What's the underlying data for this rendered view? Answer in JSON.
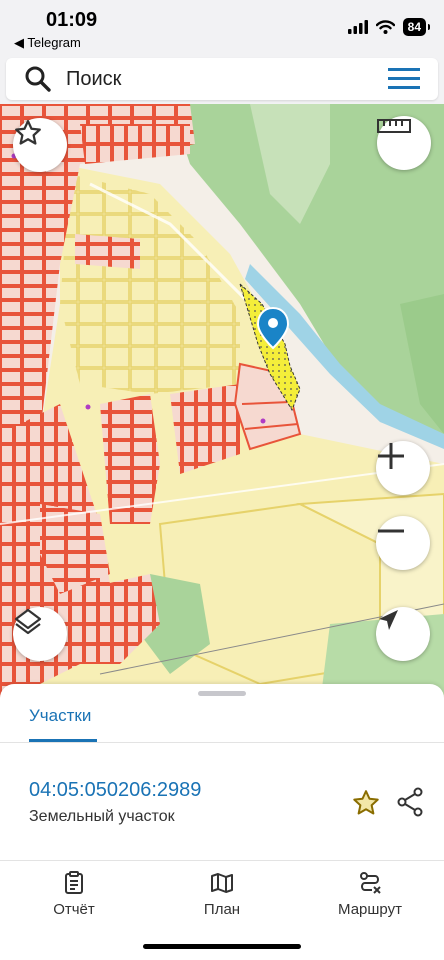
{
  "status_bar": {
    "time": "01:09",
    "back_app": "◀ Telegram",
    "battery": "84"
  },
  "search": {
    "placeholder": "Поиск",
    "icon": "search-icon",
    "menu_icon": "hamburger-menu-icon"
  },
  "map": {
    "buttons": {
      "favorites_icon": "star-icon",
      "ruler_icon": "ruler-icon",
      "zoom_in_icon": "plus-icon",
      "zoom_out_icon": "minus-icon",
      "layers_icon": "layers-icon",
      "locate_icon": "navigation-arrow-icon"
    },
    "colors": {
      "parcel_fill": "#f6d9d0",
      "parcel_outline": "#e8543a",
      "land_fill": "#f7efb6",
      "land_outline": "#e6d26a",
      "forest": "#a9d39a",
      "selected": "#f4ee3a",
      "marker": "#1a84c7"
    }
  },
  "sheet": {
    "tab_label": "Участки",
    "parcel_number": "04:05:050206:2989",
    "parcel_type": "Земельный участок",
    "favorite_icon": "star-outline-icon",
    "share_icon": "share-icon"
  },
  "bottom_nav": {
    "items": [
      {
        "label": "Отчёт",
        "icon": "report-icon"
      },
      {
        "label": "План",
        "icon": "map-plan-icon"
      },
      {
        "label": "Маршрут",
        "icon": "route-icon"
      }
    ]
  },
  "accent_color": "#1a73b5"
}
